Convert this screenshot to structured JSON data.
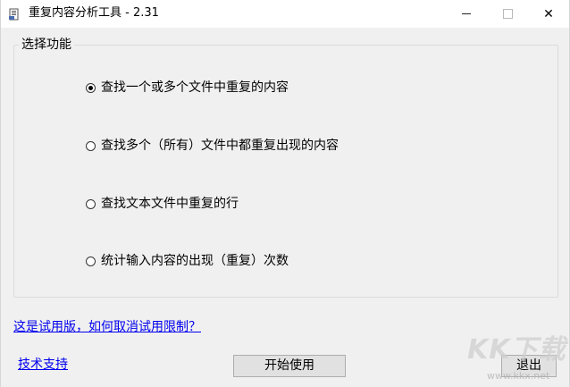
{
  "window": {
    "title": "重复内容分析工具 - 2.31",
    "icon": "app-icon",
    "controls": {
      "minimize": "—",
      "close": "✕"
    }
  },
  "group": {
    "title": "选择功能",
    "options": [
      {
        "label": "查找一个或多个文件中重复的内容",
        "checked": true
      },
      {
        "label": "查找多个（所有）文件中都重复出现的内容",
        "checked": false
      },
      {
        "label": "查找文本文件中重复的行",
        "checked": false
      },
      {
        "label": "统计输入内容的出现（重复）次数",
        "checked": false
      }
    ]
  },
  "links": {
    "trial": "这是试用版，如何取消试用限制？",
    "support": "技术支持"
  },
  "buttons": {
    "start": "开始使用",
    "exit": "退出"
  },
  "watermark": {
    "big": "KK下载",
    "small": "www.kkx.net"
  }
}
